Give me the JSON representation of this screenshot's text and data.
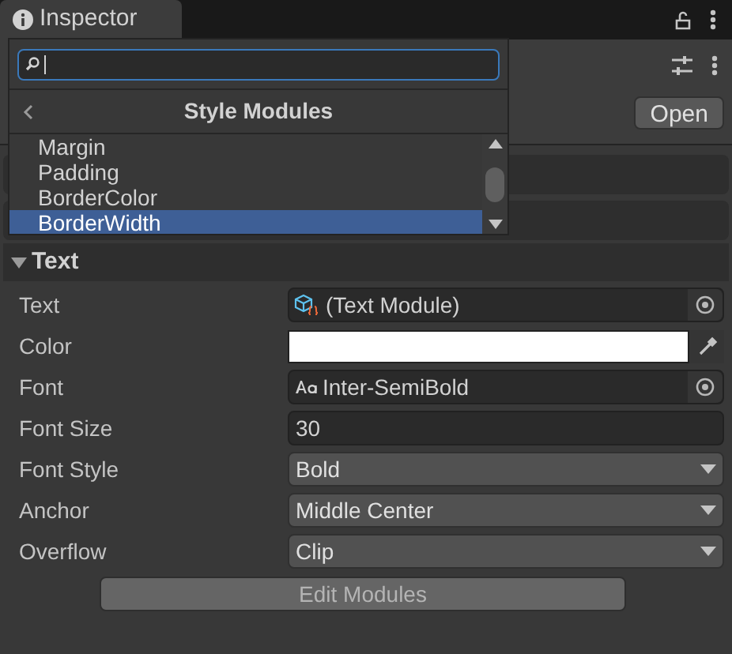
{
  "tab": {
    "title": "Inspector"
  },
  "toolbar": {
    "open_button": "Open"
  },
  "section": {
    "title": "Text",
    "expanded": true
  },
  "fields": [
    {
      "label": "Text",
      "kind": "object",
      "value": "(Text Module)"
    },
    {
      "label": "Color",
      "kind": "color",
      "color": "#ffffff"
    },
    {
      "label": "Font",
      "kind": "font",
      "value": "Inter-SemiBold"
    },
    {
      "label": "Font Size",
      "kind": "number",
      "value": "30"
    },
    {
      "label": "Font Style",
      "kind": "dropdown",
      "value": "Bold"
    },
    {
      "label": "Anchor",
      "kind": "dropdown",
      "value": "Middle Center"
    },
    {
      "label": "Overflow",
      "kind": "dropdown",
      "value": "Clip"
    }
  ],
  "edit_button": "Edit Modules",
  "popup": {
    "title": "Style Modules",
    "items": [
      {
        "label": "Margin",
        "selected": false
      },
      {
        "label": "Padding",
        "selected": false
      },
      {
        "label": "BorderColor",
        "selected": false
      },
      {
        "label": "BorderWidth",
        "selected": true
      }
    ]
  }
}
